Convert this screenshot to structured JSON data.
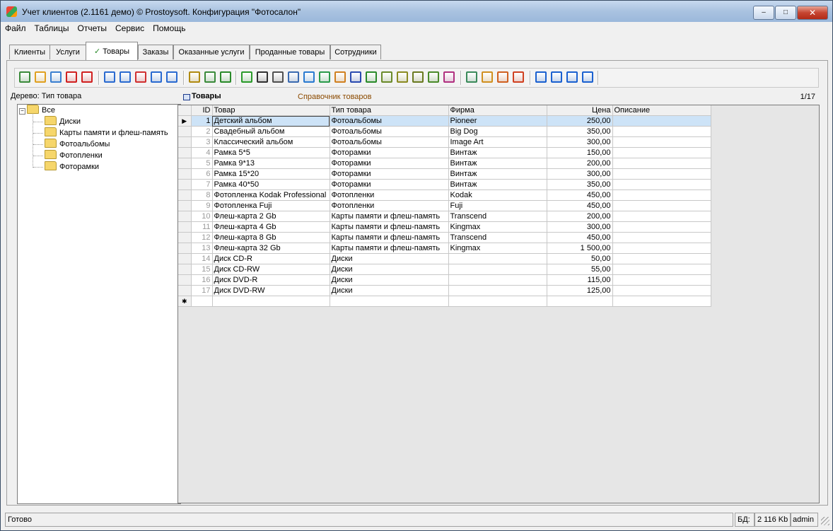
{
  "window": {
    "title": "Учет клиентов (2.1161 демо) © Prostoysoft. Конфигурация \"Фотосалон\"",
    "minimize_label": "–",
    "maximize_label": "□",
    "close_label": "✕"
  },
  "menu": [
    "Файл",
    "Таблицы",
    "Отчеты",
    "Сервис",
    "Помощь"
  ],
  "tabs": [
    {
      "label": "Клиенты",
      "active": false
    },
    {
      "label": "Услуги",
      "active": false
    },
    {
      "label": "Товары",
      "active": true
    },
    {
      "label": "Заказы",
      "active": false
    },
    {
      "label": "Оказанные услуги",
      "active": false
    },
    {
      "label": "Проданные товары",
      "active": false
    },
    {
      "label": "Сотрудники",
      "active": false
    }
  ],
  "toolbar_icons": [
    {
      "name": "add-record-icon",
      "color": "#3a8a3a"
    },
    {
      "name": "edit-record-icon",
      "color": "#e0a020"
    },
    {
      "name": "copy-record-icon",
      "color": "#3a7fd0"
    },
    {
      "name": "delete-record-icon",
      "color": "#d02020"
    },
    {
      "name": "delete-all-icon",
      "color": "#d02020"
    },
    {
      "name": "filter-icon",
      "color": "#2a6ad0"
    },
    {
      "name": "filter-add-icon",
      "color": "#2a6ad0"
    },
    {
      "name": "filter-remove-icon",
      "color": "#d03030"
    },
    {
      "name": "filter-clear-icon",
      "color": "#2a6ad0"
    },
    {
      "name": "filter-edit-icon",
      "color": "#2a6ad0"
    },
    {
      "name": "filter-tree-icon",
      "color": "#b08a10"
    },
    {
      "name": "tree-view-icon",
      "color": "#3a8a3a"
    },
    {
      "name": "sql-query-icon",
      "color": "#2a8a2a"
    },
    {
      "name": "refresh-icon",
      "color": "#2a9a2a"
    },
    {
      "name": "find-binoculars-icon",
      "color": "#303030"
    },
    {
      "name": "print-icon",
      "color": "#505050"
    },
    {
      "name": "print-preview-icon",
      "color": "#3a6ab0"
    },
    {
      "name": "export-icon",
      "color": "#2a7ad0"
    },
    {
      "name": "export-copy-icon",
      "color": "#2a9a4a"
    },
    {
      "name": "export-html-icon",
      "color": "#d08020"
    },
    {
      "name": "export-word-icon",
      "color": "#2a4ab0"
    },
    {
      "name": "export-excel-icon",
      "color": "#2a8a2a"
    },
    {
      "name": "export-text-icon",
      "color": "#6a8a2a"
    },
    {
      "name": "export-xml-icon",
      "color": "#8a8a20"
    },
    {
      "name": "export-csv-icon",
      "color": "#6a7a20"
    },
    {
      "name": "export-dbf-icon",
      "color": "#4a8a2a"
    },
    {
      "name": "chart-icon",
      "color": "#b03080"
    },
    {
      "name": "report-icon",
      "color": "#3a8a5a"
    },
    {
      "name": "report-edit-icon",
      "color": "#d09020"
    },
    {
      "name": "columns-icon",
      "color": "#d06020"
    },
    {
      "name": "settings-grid-icon",
      "color": "#d04020"
    },
    {
      "name": "first-record-icon",
      "color": "#1a60d0"
    },
    {
      "name": "prev-record-icon",
      "color": "#1a60d0"
    },
    {
      "name": "next-record-icon",
      "color": "#1a60d0"
    },
    {
      "name": "last-record-icon",
      "color": "#1a60d0"
    }
  ],
  "tree": {
    "label": "Дерево: Тип товара",
    "root": "Все",
    "expander": "−",
    "items": [
      "Диски",
      "Карты памяти и флеш-память",
      "Фотоальбомы",
      "Фотопленки",
      "Фоторамки"
    ]
  },
  "grid": {
    "title": "Товары",
    "subtitle": "Справочник товаров",
    "counter": "1/17",
    "columns": [
      "ID",
      "Товар",
      "Тип товара",
      "Фирма",
      "Цена",
      "Описание"
    ],
    "rows": [
      {
        "id": "1",
        "name": "Детский альбом",
        "type": "Фотоальбомы",
        "firm": "Pioneer",
        "price": "250,00",
        "desc": ""
      },
      {
        "id": "2",
        "name": "Свадебный альбом",
        "type": "Фотоальбомы",
        "firm": "Big Dog",
        "price": "350,00",
        "desc": ""
      },
      {
        "id": "3",
        "name": "Классический альбом",
        "type": "Фотоальбомы",
        "firm": "Image Art",
        "price": "300,00",
        "desc": ""
      },
      {
        "id": "4",
        "name": "Рамка 5*5",
        "type": "Фоторамки",
        "firm": "Винтаж",
        "price": "150,00",
        "desc": ""
      },
      {
        "id": "5",
        "name": "Рамка 9*13",
        "type": "Фоторамки",
        "firm": "Винтаж",
        "price": "200,00",
        "desc": ""
      },
      {
        "id": "6",
        "name": "Рамка 15*20",
        "type": "Фоторамки",
        "firm": "Винтаж",
        "price": "300,00",
        "desc": ""
      },
      {
        "id": "7",
        "name": "Рамка 40*50",
        "type": "Фоторамки",
        "firm": "Винтаж",
        "price": "350,00",
        "desc": ""
      },
      {
        "id": "8",
        "name": "Фотопленка Kodak Professional",
        "type": "Фотопленки",
        "firm": "Kodak",
        "price": "450,00",
        "desc": ""
      },
      {
        "id": "9",
        "name": "Фотопленка Fuji",
        "type": "Фотопленки",
        "firm": "Fuji",
        "price": "450,00",
        "desc": ""
      },
      {
        "id": "10",
        "name": "Флеш-карта 2 Gb",
        "type": "Карты памяти и флеш-память",
        "firm": "Transcend",
        "price": "200,00",
        "desc": ""
      },
      {
        "id": "11",
        "name": "Флеш-карта 4 Gb",
        "type": "Карты памяти и флеш-память",
        "firm": "Kingmax",
        "price": "300,00",
        "desc": ""
      },
      {
        "id": "12",
        "name": "Флеш-карта 8 Gb",
        "type": "Карты памяти и флеш-память",
        "firm": "Transcend",
        "price": "450,00",
        "desc": ""
      },
      {
        "id": "13",
        "name": "Флеш-карта 32 Gb",
        "type": "Карты памяти и флеш-память",
        "firm": "Kingmax",
        "price": "1 500,00",
        "desc": ""
      },
      {
        "id": "14",
        "name": "Диск CD-R",
        "type": "Диски",
        "firm": "",
        "price": "50,00",
        "desc": ""
      },
      {
        "id": "15",
        "name": "Диск CD-RW",
        "type": "Диски",
        "firm": "",
        "price": "55,00",
        "desc": ""
      },
      {
        "id": "16",
        "name": "Диск DVD-R",
        "type": "Диски",
        "firm": "",
        "price": "115,00",
        "desc": ""
      },
      {
        "id": "17",
        "name": "Диск DVD-RW",
        "type": "Диски",
        "firm": "",
        "price": "125,00",
        "desc": ""
      }
    ],
    "current_row_marker": "▶",
    "new_row_marker": "✱"
  },
  "status": {
    "text": "Готово",
    "db_label": "БД:",
    "db_size": "2 116 Kb",
    "user": "admin"
  }
}
